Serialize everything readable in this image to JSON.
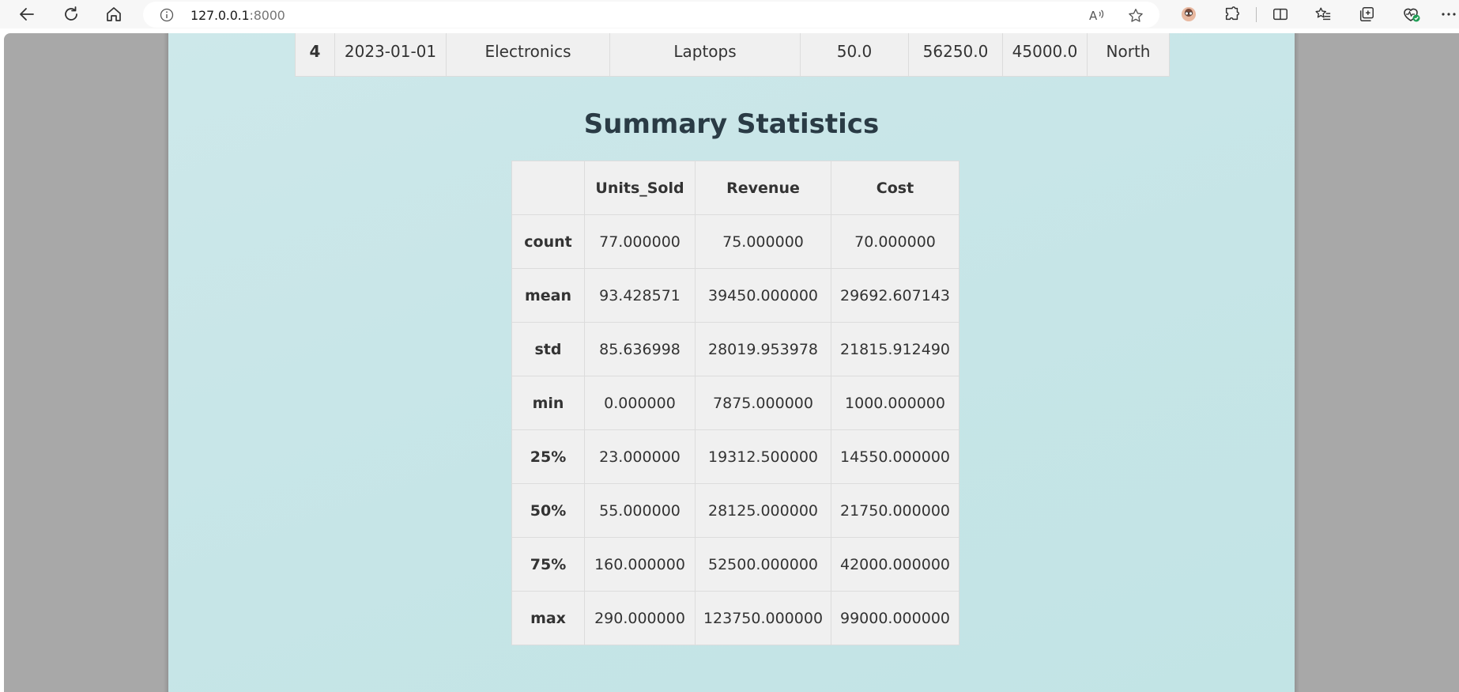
{
  "browser": {
    "url_host": "127.0.0.1",
    "url_port": ":8000"
  },
  "top_row": {
    "cells": [
      "4",
      "2023-01-01",
      "Electronics",
      "Laptops",
      "50.0",
      "56250.0",
      "45000.0",
      "North"
    ]
  },
  "summary": {
    "title": "Summary Statistics",
    "columns": [
      "",
      "Units_Sold",
      "Revenue",
      "Cost"
    ],
    "rows": [
      {
        "label": "count",
        "values": [
          "77.000000",
          "75.000000",
          "70.000000"
        ]
      },
      {
        "label": "mean",
        "values": [
          "93.428571",
          "39450.000000",
          "29692.607143"
        ]
      },
      {
        "label": "std",
        "values": [
          "85.636998",
          "28019.953978",
          "21815.912490"
        ]
      },
      {
        "label": "min",
        "values": [
          "0.000000",
          "7875.000000",
          "1000.000000"
        ]
      },
      {
        "label": "25%",
        "values": [
          "23.000000",
          "19312.500000",
          "14550.000000"
        ]
      },
      {
        "label": "50%",
        "values": [
          "55.000000",
          "28125.000000",
          "21750.000000"
        ]
      },
      {
        "label": "75%",
        "values": [
          "160.000000",
          "52500.000000",
          "42000.000000"
        ]
      },
      {
        "label": "max",
        "values": [
          "290.000000",
          "123750.000000",
          "99000.000000"
        ]
      }
    ]
  },
  "icons": {
    "back": "back-arrow-icon",
    "refresh": "refresh-icon",
    "home": "home-icon",
    "info": "info-icon",
    "read_aloud": "read-aloud-icon",
    "favorite": "star-icon",
    "profile": "profile-icon",
    "extensions": "puzzle-icon",
    "split": "split-screen-icon",
    "favorites": "favorites-list-icon",
    "collections": "collections-icon",
    "health": "browser-essentials-icon",
    "more": "more-icon"
  }
}
